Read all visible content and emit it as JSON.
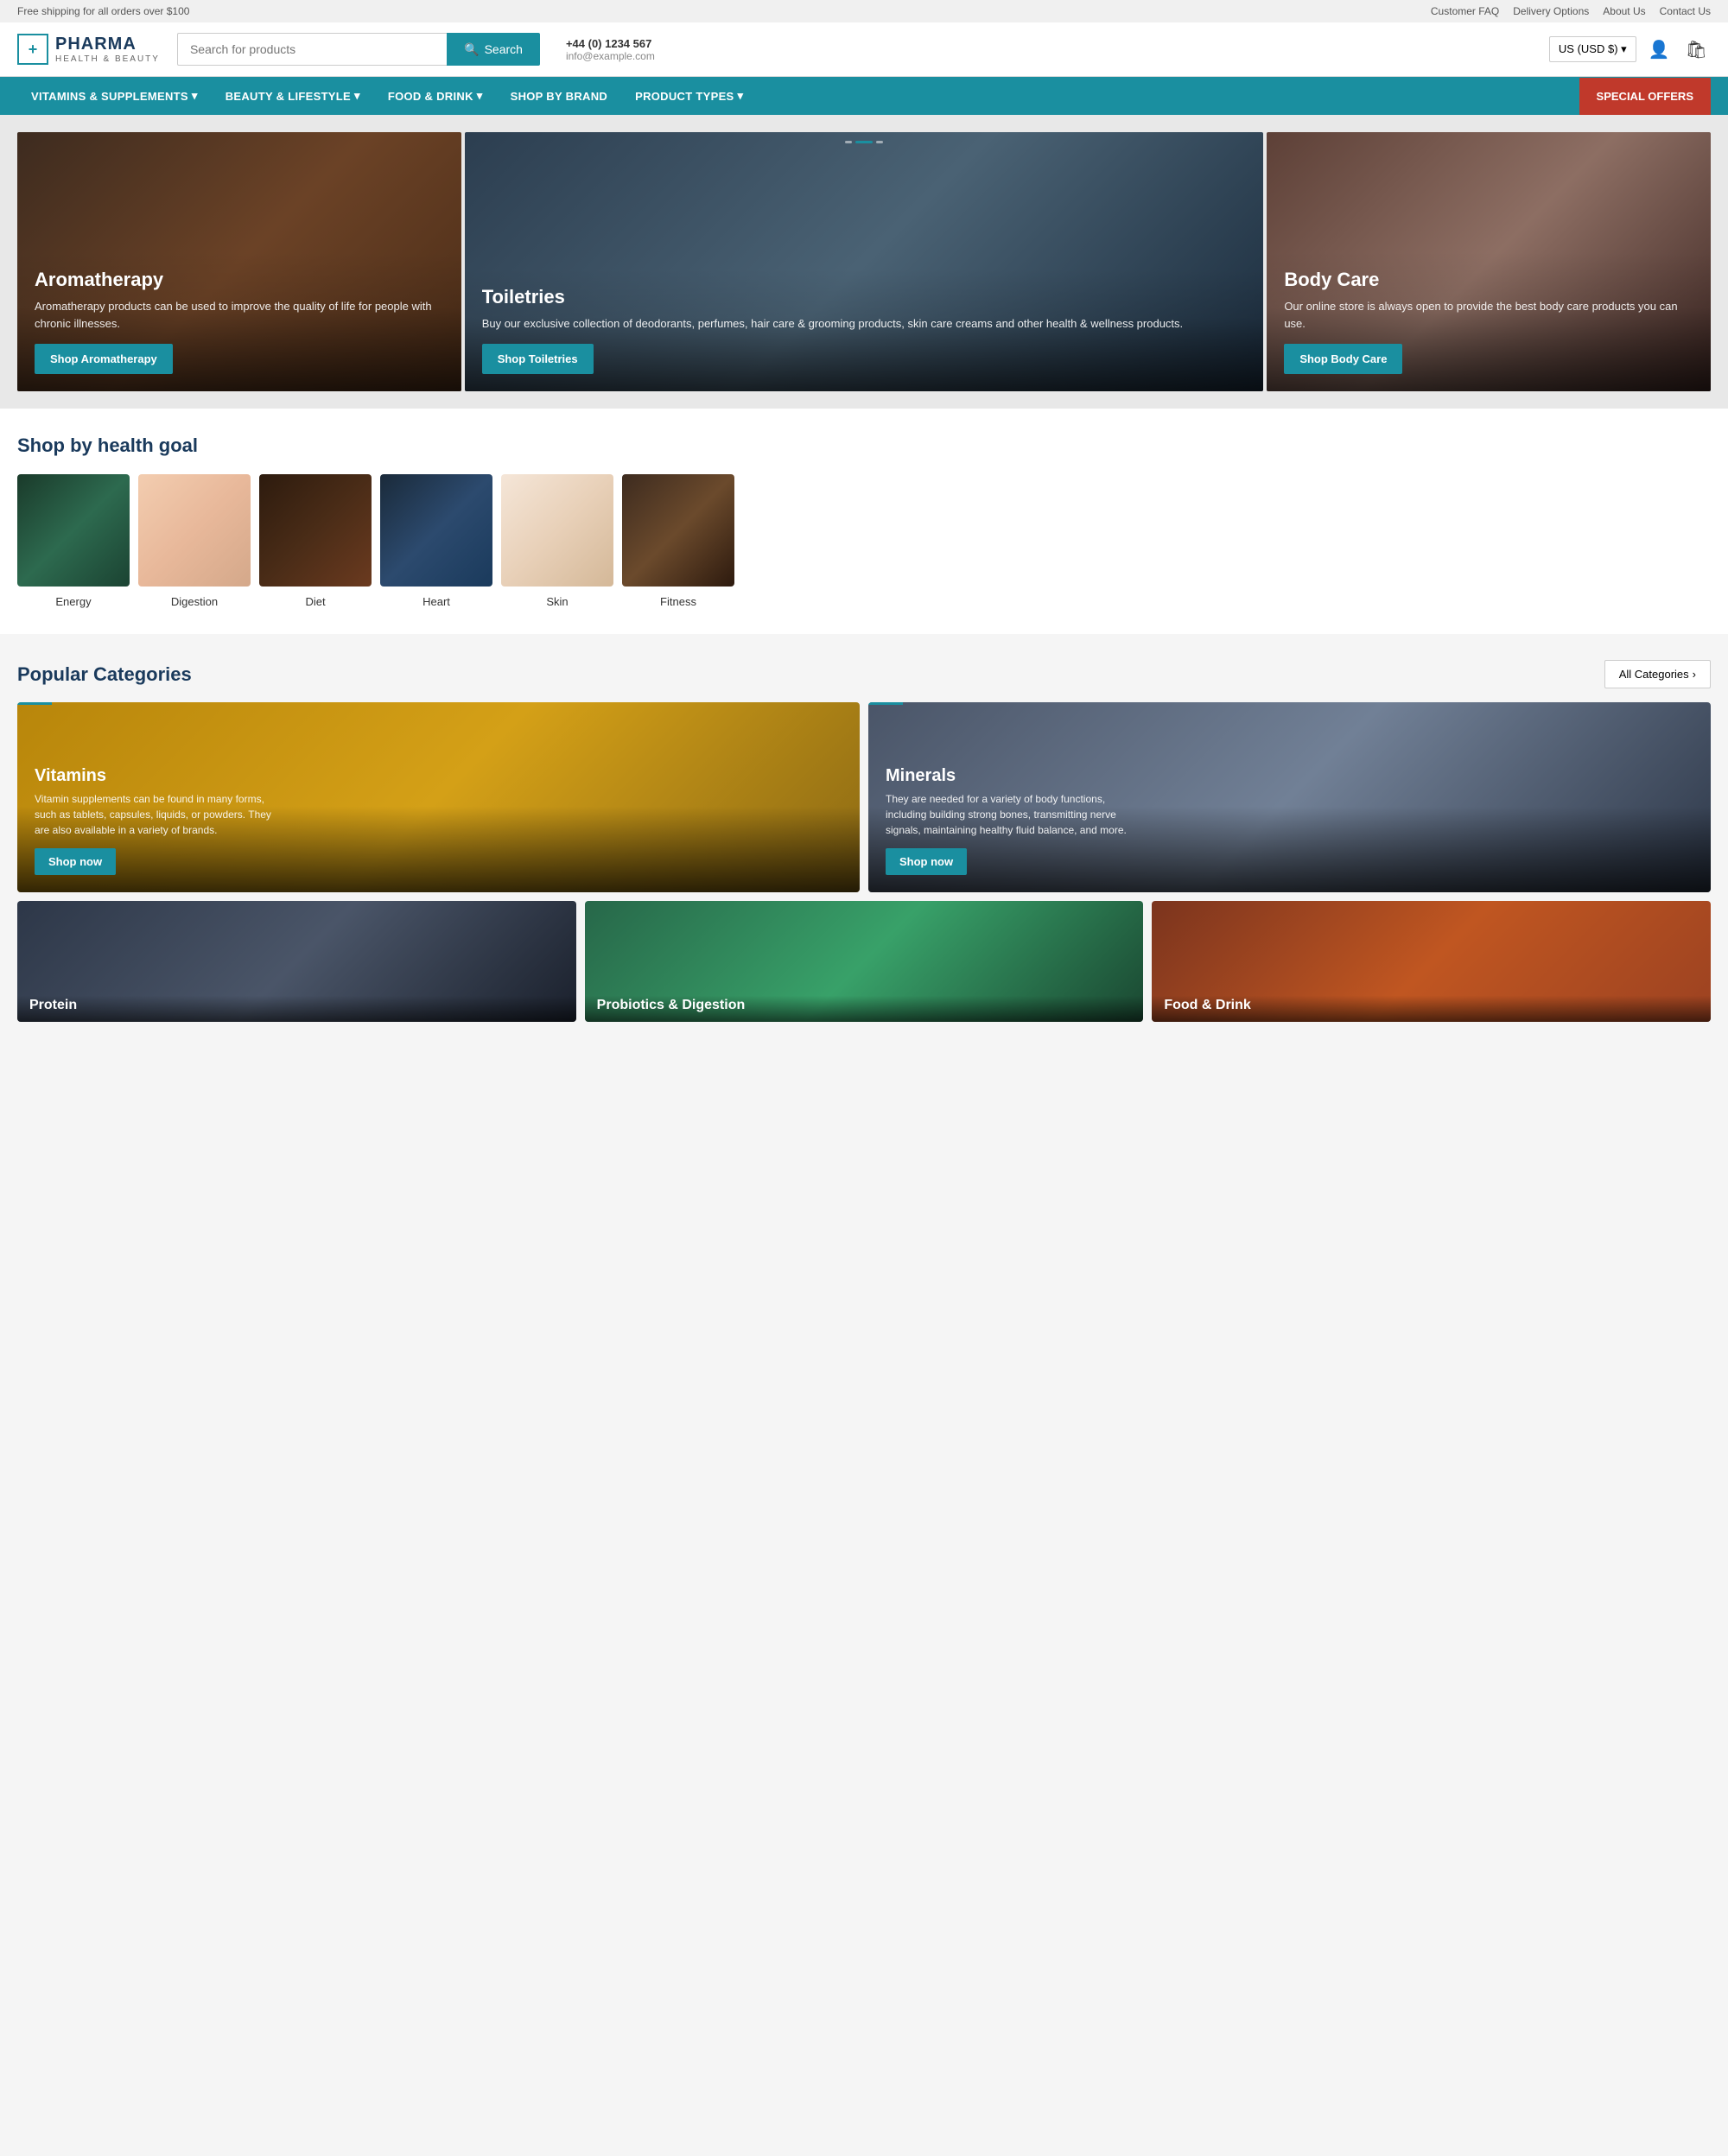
{
  "topbar": {
    "shipping_notice": "Free shipping for all orders over $100",
    "links": [
      "Customer FAQ",
      "Delivery Options",
      "About Us",
      "Contact Us"
    ]
  },
  "header": {
    "logo_name": "PHARMA",
    "logo_sub": "HEALTH & BEAUTY",
    "search_placeholder": "Search for products",
    "search_label": "Search",
    "phone": "+44 (0) 1234 567",
    "email": "info@example.com",
    "currency": "US (USD $)",
    "currency_arrow": "▾"
  },
  "nav": {
    "items": [
      {
        "label": "VITAMINS & SUPPLEMENTS",
        "has_dropdown": true
      },
      {
        "label": "BEAUTY & LIFESTYLE",
        "has_dropdown": true
      },
      {
        "label": "FOOD & DRINK",
        "has_dropdown": true
      },
      {
        "label": "SHOP BY BRAND",
        "has_dropdown": false
      },
      {
        "label": "PRODUCT TYPES",
        "has_dropdown": true
      }
    ],
    "special": "SPECIAL OFFERS"
  },
  "hero": {
    "cards": [
      {
        "title": "Aromatherapy",
        "desc": "Aromatherapy products can be used to improve the quality of life for people with chronic illnesses.",
        "btn_label": "Shop Aromatherapy",
        "bg_class": "bg-aroma"
      },
      {
        "title": "Toiletries",
        "desc": "Buy our exclusive collection of deodorants, perfumes, hair care & grooming products, skin care creams and other health & wellness products.",
        "btn_label": "Shop Toiletries",
        "bg_class": "bg-toilet"
      },
      {
        "title": "Body Care",
        "desc": "Our online store is always open to provide the best body care products you can use.",
        "btn_label": "Shop Body Care",
        "bg_class": "bg-body"
      }
    ]
  },
  "health_goals": {
    "section_title": "Shop by health goal",
    "items": [
      {
        "label": "Energy",
        "bg_class": "bg-energy"
      },
      {
        "label": "Digestion",
        "bg_class": "bg-digestion"
      },
      {
        "label": "Diet",
        "bg_class": "bg-diet"
      },
      {
        "label": "Heart",
        "bg_class": "bg-heart"
      },
      {
        "label": "Skin",
        "bg_class": "bg-skin"
      },
      {
        "label": "Fitness",
        "bg_class": "bg-fitness"
      }
    ]
  },
  "popular_categories": {
    "section_title": "Popular Categories",
    "all_categories_label": "All Categories",
    "top_cards": [
      {
        "title": "Vitamins",
        "desc": "Vitamin supplements can be found in many forms, such as tablets, capsules, liquids, or powders. They are also available in a variety of brands.",
        "btn_label": "Shop now",
        "bg_class": "bg-vitamins"
      },
      {
        "title": "Minerals",
        "desc": "They are needed for a variety of body functions, including building strong bones, transmitting nerve signals, maintaining healthy fluid balance, and more.",
        "btn_label": "Shop now",
        "bg_class": "bg-minerals"
      }
    ],
    "bottom_cards": [
      {
        "title": "Protein",
        "bg_class": "bg-protein"
      },
      {
        "title": "Probiotics & Digestion",
        "bg_class": "bg-probiotics"
      },
      {
        "title": "Food & Drink",
        "bg_class": "bg-food"
      }
    ]
  }
}
